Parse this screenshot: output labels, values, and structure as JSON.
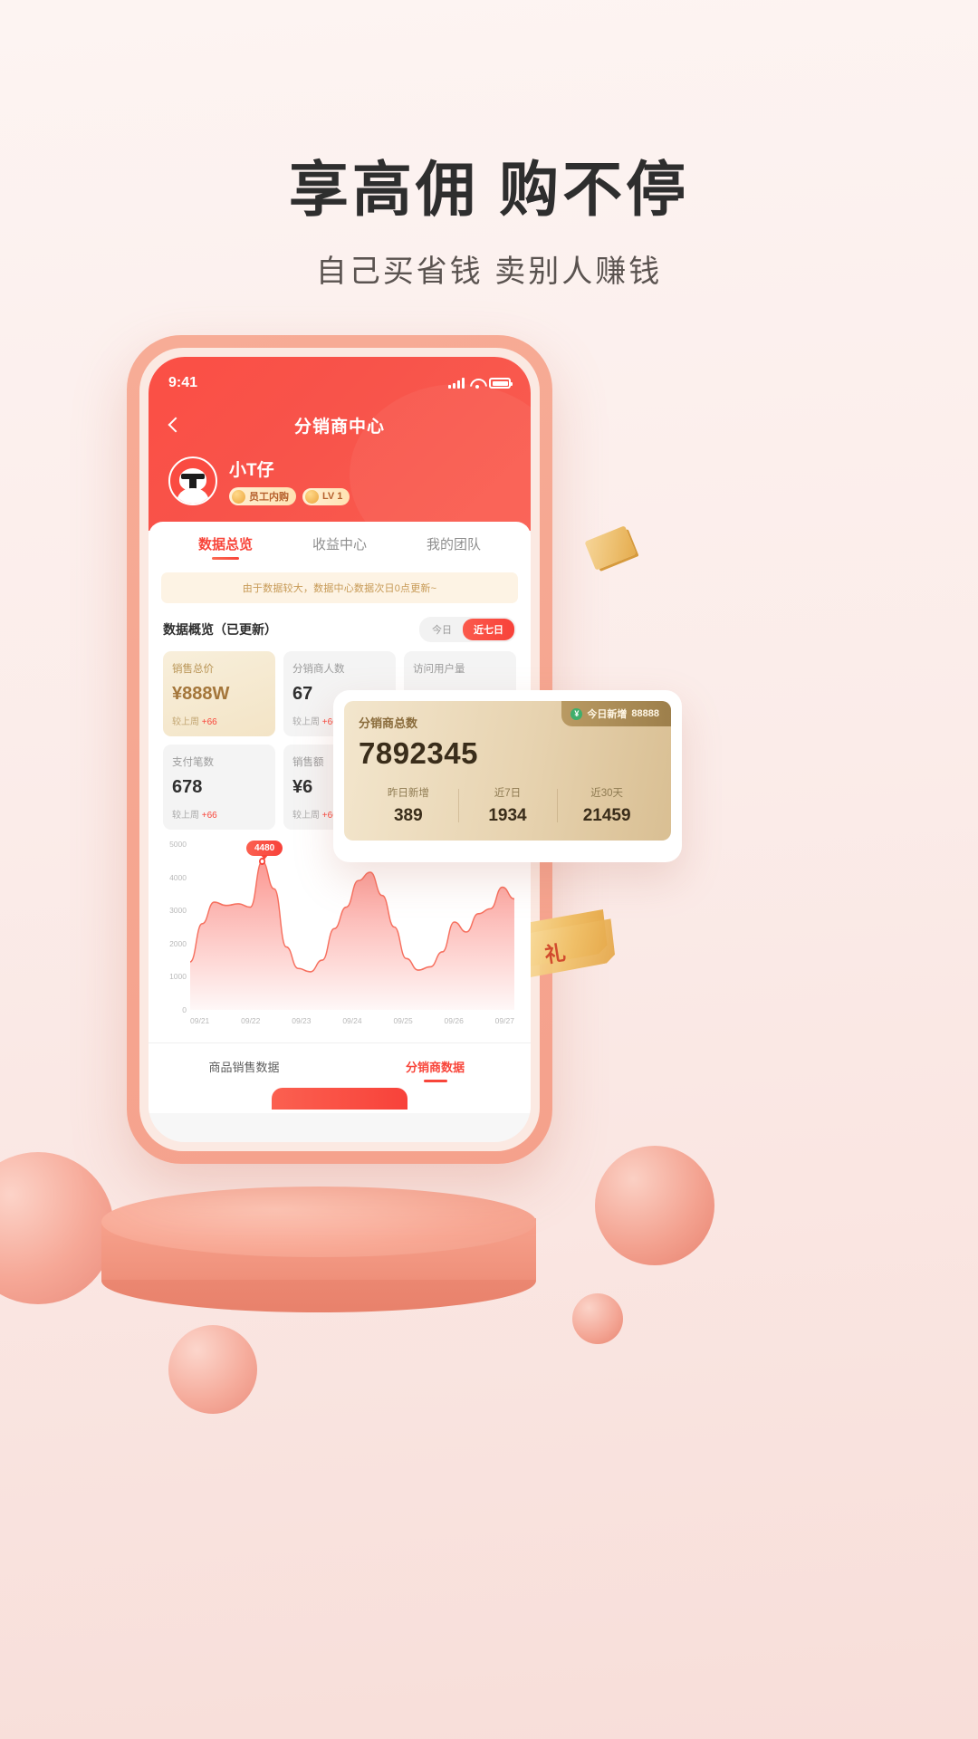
{
  "promo": {
    "title": "享高佣  购不停",
    "subtitle": "自己买省钱  卖别人赚钱"
  },
  "phone": {
    "status_bar": {
      "time": "9:41"
    },
    "nav": {
      "title": "分销商中心",
      "back_icon": "chevron-left-icon"
    },
    "profile": {
      "name": "小T仔",
      "badges": [
        {
          "label": "员工内购"
        },
        {
          "label": "LV 1"
        }
      ]
    },
    "tabs": [
      {
        "label": "数据总览",
        "active": true
      },
      {
        "label": "收益中心",
        "active": false
      },
      {
        "label": "我的团队",
        "active": false
      }
    ],
    "notice": "由于数据较大，数据中心数据次日0点更新~",
    "overview": {
      "title": "数据概览（已更新）",
      "range_toggles": [
        {
          "label": "今日",
          "active": false
        },
        {
          "label": "近七日",
          "active": true
        }
      ],
      "cards": [
        {
          "label": "销售总价",
          "value": "¥888W",
          "delta_prefix": "较上周",
          "delta": "+66",
          "gold": true
        },
        {
          "label": "分销商人数",
          "value": "67",
          "delta_prefix": "较上周",
          "delta": "+66",
          "gold": false
        },
        {
          "label": "访问用户量",
          "value": "",
          "delta_prefix": "",
          "delta": "",
          "gold": false
        },
        {
          "label": "支付笔数",
          "value": "678",
          "delta_prefix": "较上周",
          "delta": "+66",
          "gold": false
        },
        {
          "label": "销售额",
          "value": "¥6",
          "delta_prefix": "较上周",
          "delta": "+66",
          "gold": false
        },
        {
          "label": "",
          "value": "",
          "delta_prefix": "",
          "delta": "",
          "gold": false
        }
      ]
    },
    "bottom_tabs": [
      {
        "label": "商品销售数据",
        "active": false
      },
      {
        "label": "分销商数据",
        "active": true
      }
    ]
  },
  "popup": {
    "label": "分销商总数",
    "number": "7892345",
    "today_badge": {
      "icon": "money-circle-icon",
      "label": "今日新增",
      "value": "88888"
    },
    "columns": [
      {
        "label": "昨日新增",
        "value": "389"
      },
      {
        "label": "近7日",
        "value": "1934"
      },
      {
        "label": "近30天",
        "value": "21459"
      }
    ]
  },
  "chart_data": {
    "type": "area",
    "title": "",
    "xlabel": "",
    "ylabel": "",
    "ylim": [
      0,
      5000
    ],
    "yticks": [
      0,
      1000,
      2000,
      3000,
      4000,
      5000
    ],
    "grid": false,
    "categories": [
      "09/21",
      "09/22",
      "09/23",
      "09/24",
      "09/25",
      "09/26",
      "09/27"
    ],
    "x": [
      0,
      1,
      2,
      3,
      4,
      5,
      6,
      7,
      8,
      9,
      10,
      11,
      12,
      13,
      14,
      15,
      16,
      17,
      18,
      19,
      20,
      21,
      22,
      23,
      24,
      25,
      26,
      27
    ],
    "values": [
      1450,
      2600,
      3250,
      3150,
      3200,
      3100,
      4480,
      3650,
      1900,
      1250,
      1150,
      1500,
      2450,
      3100,
      3900,
      4150,
      3450,
      2500,
      1550,
      1200,
      1300,
      1750,
      2650,
      2350,
      2900,
      3050,
      3700,
      3350
    ],
    "annotation": {
      "label": "4480",
      "x_index": 6,
      "value": 4480
    },
    "series": [
      {
        "name": "分销商数据",
        "color": "#f8453a"
      }
    ]
  }
}
